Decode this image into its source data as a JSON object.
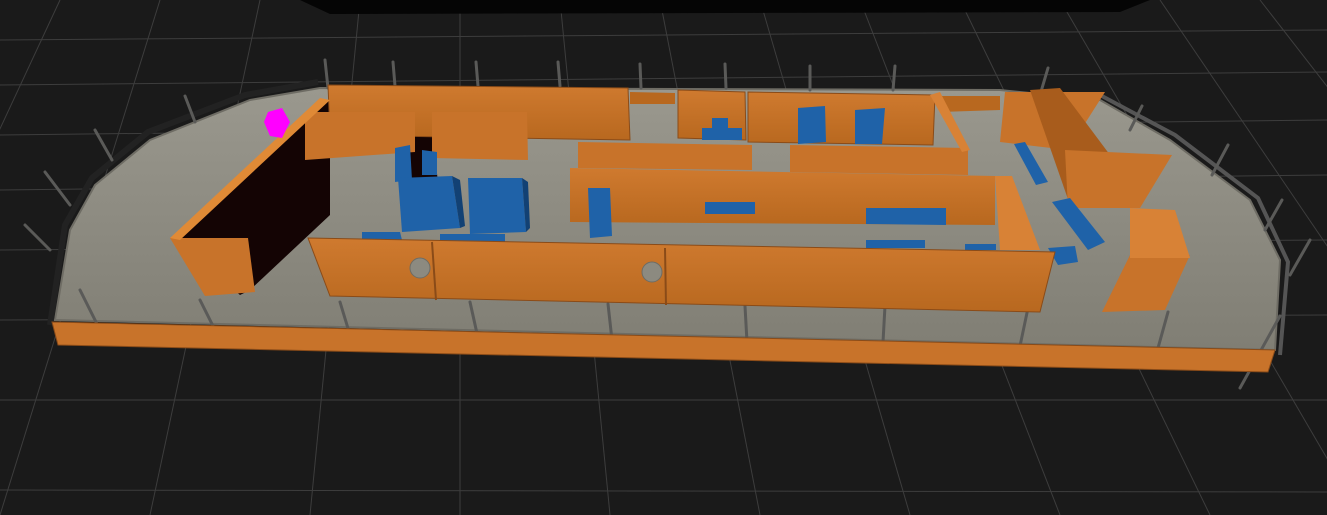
{
  "scene": {
    "background_color": "#1a1a1a",
    "grid_color": "#3c3c3c",
    "floor_color": "#8c8a80",
    "railing_color": "#4a4a48",
    "wall_color": "#c8732a",
    "wall_top_color": "#e08a36",
    "wall_shadow_color": "#8a4b18",
    "furniture_color": "#1f62a8",
    "furniture_dark_color": "#124174",
    "marker_color": "#ff00ff",
    "interior_dark_color": "#140404"
  }
}
